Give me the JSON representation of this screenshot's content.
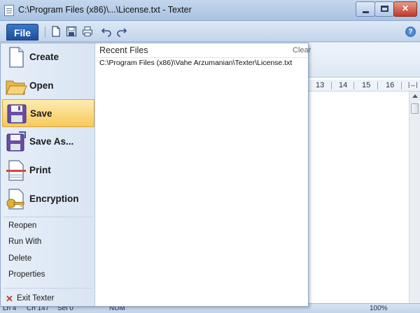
{
  "window": {
    "title": "C:\\Program Files (x86)\\...\\License.txt - Texter"
  },
  "toolbar": {
    "file_tab": "File",
    "help": "?"
  },
  "file_menu": {
    "items": [
      {
        "label": "Create",
        "icon": "new-document-icon"
      },
      {
        "label": "Open",
        "icon": "open-folder-icon"
      },
      {
        "label": "Save",
        "icon": "floppy-disk-icon",
        "active": true
      },
      {
        "label": "Save As...",
        "icon": "save-as-icon"
      },
      {
        "label": "Print",
        "icon": "printer-icon"
      },
      {
        "label": "Encryption",
        "icon": "key-icon"
      }
    ],
    "secondary_items": [
      "Reopen",
      "Run With",
      "Delete",
      "Properties"
    ],
    "exit_label": "Exit Texter"
  },
  "recent_files": {
    "title": "Recent Files",
    "clear_label": "Clear",
    "items": [
      "C:\\Program Files (x86)\\Vahe Arzumanian\\Texter\\License.txt"
    ]
  },
  "ruler": {
    "ticks": [
      "13",
      "14",
      "15",
      "16"
    ]
  },
  "statusbar": {
    "line": "Ln 4",
    "col": "Ch 147",
    "sel": "Sel 0",
    "mode": "NUM",
    "zoom": "100%"
  },
  "colors": {
    "accent": "#1e4f9a",
    "active_item": "#f8c95a",
    "exit": "#c0392b"
  }
}
